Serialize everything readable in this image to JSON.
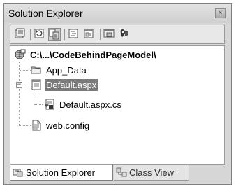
{
  "window": {
    "title": "Solution Explorer",
    "close_glyph": "×"
  },
  "toolbar": {
    "buttons": [
      {
        "icon": "properties-icon"
      },
      {
        "icon": "refresh-icon"
      },
      {
        "icon": "show-all-files-icon",
        "pressed": true
      },
      {
        "icon": "view-code-icon"
      },
      {
        "icon": "view-designer-icon"
      },
      {
        "icon": "copy-website-icon"
      },
      {
        "icon": "asp-net-configuration-icon"
      }
    ]
  },
  "tree": {
    "root": {
      "label": "C:\\...\\CodeBehindPageModel\\",
      "icon": "website-project-icon"
    },
    "items": [
      {
        "label": "App_Data",
        "icon": "folder-icon"
      },
      {
        "label": "Default.aspx",
        "icon": "aspx-page-icon",
        "selected": true,
        "expanded": true
      },
      {
        "label": "Default.aspx.cs",
        "icon": "csharp-file-icon"
      },
      {
        "label": "web.config",
        "icon": "config-file-icon"
      }
    ]
  },
  "tabs": [
    {
      "label": "Solution Explorer",
      "icon": "solution-explorer-icon",
      "active": true
    },
    {
      "label": "Class View",
      "icon": "class-view-icon",
      "active": false
    }
  ],
  "colors": {
    "selection": "#7a7a7a",
    "panel_border": "#9a9a9a",
    "titlebar": "#d6d6d6"
  }
}
